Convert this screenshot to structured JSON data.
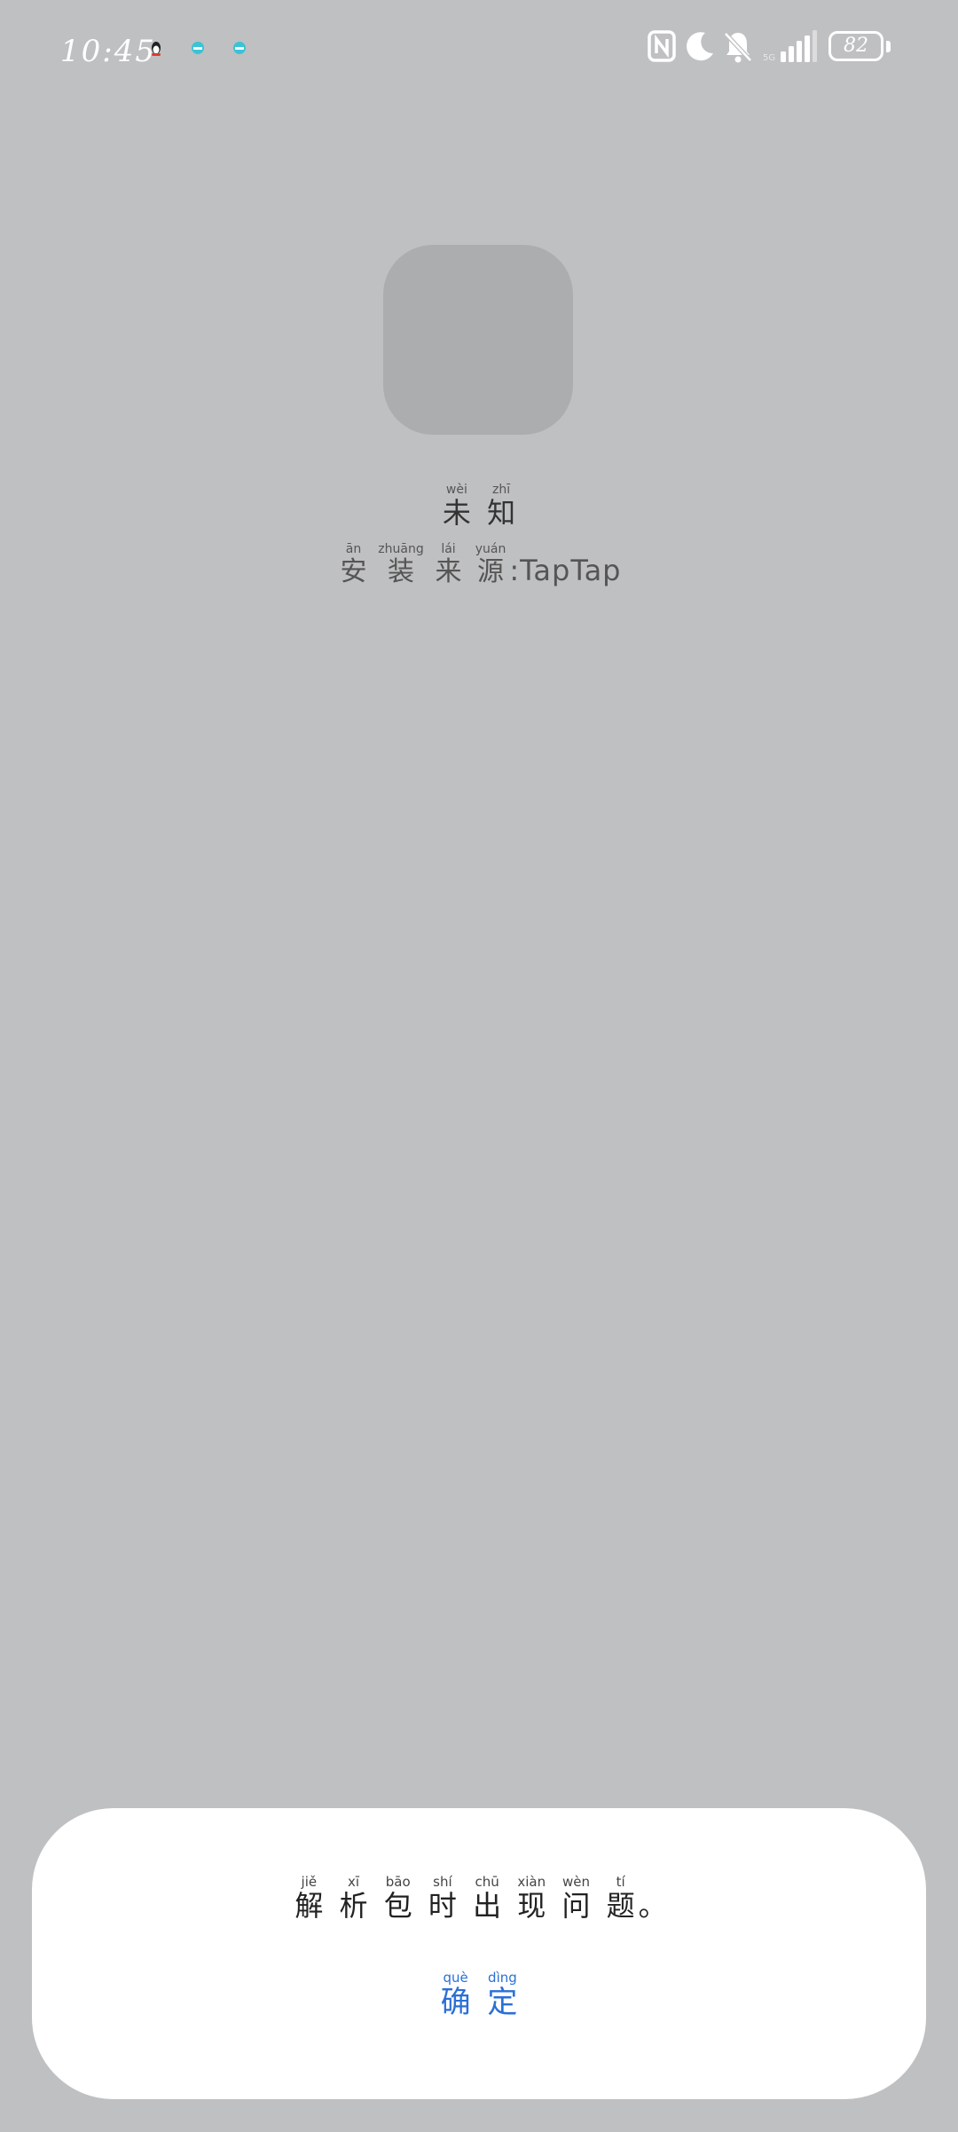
{
  "status_bar": {
    "time": "10:45",
    "battery_level": "82",
    "signal_label": "5G"
  },
  "app_info": {
    "name_chars": [
      {
        "char": "未",
        "pinyin": "wèi"
      },
      {
        "char": "知",
        "pinyin": "zhī"
      }
    ],
    "install_source_chars": [
      {
        "char": "安",
        "pinyin": "ān"
      },
      {
        "char": "装",
        "pinyin": "zhuāng"
      },
      {
        "char": "来",
        "pinyin": "lái"
      },
      {
        "char": "源",
        "pinyin": "yuán"
      }
    ],
    "install_source_value": ":TapTap"
  },
  "dialog": {
    "message_chars": [
      {
        "char": "解",
        "pinyin": "jiě"
      },
      {
        "char": "析",
        "pinyin": "xī"
      },
      {
        "char": "包",
        "pinyin": "bāo"
      },
      {
        "char": "时",
        "pinyin": "shí"
      },
      {
        "char": "出",
        "pinyin": "chū"
      },
      {
        "char": "现",
        "pinyin": "xiàn"
      },
      {
        "char": "问",
        "pinyin": "wèn"
      },
      {
        "char": "题",
        "pinyin": "tí"
      }
    ],
    "message_end": "。",
    "confirm_chars": [
      {
        "char": "确",
        "pinyin": "què"
      },
      {
        "char": "定",
        "pinyin": "dìng"
      }
    ]
  },
  "colors": {
    "background": "#bfc0c2",
    "dialog": "#ffffff",
    "accent": "#2b6fd6"
  },
  "icons": [
    "qq-icon",
    "cloud-icon",
    "cloud-icon",
    "nfc-icon",
    "moon-icon",
    "mute-bell-icon",
    "signal-icon",
    "battery-icon"
  ]
}
